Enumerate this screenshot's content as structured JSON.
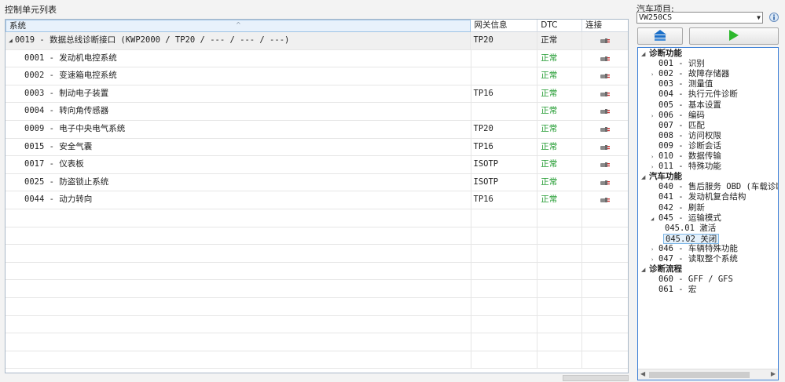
{
  "left": {
    "title": "控制单元列表",
    "columns": {
      "system": "系统",
      "gateway": "网关信息",
      "dtc": "DTC",
      "connect": "连接"
    },
    "group": {
      "system": "0019 - 数据总线诊断接口  (KWP2000 / TP20 / --- / --- / ---)",
      "gateway": "TP20",
      "dtc": "正常"
    },
    "rows": [
      {
        "system": "0001 - 发动机电控系统",
        "gateway": "",
        "dtc": "正常"
      },
      {
        "system": "0002 - 变速箱电控系统",
        "gateway": "",
        "dtc": "正常"
      },
      {
        "system": "0003 - 制动电子装置",
        "gateway": "TP16",
        "dtc": "正常"
      },
      {
        "system": "0004 - 转向角传感器",
        "gateway": "",
        "dtc": "正常"
      },
      {
        "system": "0009 - 电子中央电气系统",
        "gateway": "TP20",
        "dtc": "正常"
      },
      {
        "system": "0015 - 安全气囊",
        "gateway": "TP16",
        "dtc": "正常"
      },
      {
        "system": "0017 - 仪表板",
        "gateway": "ISOTP",
        "dtc": "正常"
      },
      {
        "system": "0025 - 防盗锁止系统",
        "gateway": "ISOTP",
        "dtc": "正常"
      },
      {
        "system": "0044 - 动力转向",
        "gateway": "TP16",
        "dtc": "正常"
      }
    ]
  },
  "right": {
    "vehicle_label": "汽车项目:",
    "vehicle_value": "VW250CS",
    "tree": [
      {
        "text": "诊断功能",
        "kind": "cat",
        "exp": "◢"
      },
      {
        "text": "001 - 识别",
        "kind": "item",
        "exp": ""
      },
      {
        "text": "002 - 故障存储器",
        "kind": "item",
        "exp": "›"
      },
      {
        "text": "003 - 测量值",
        "kind": "item",
        "exp": ""
      },
      {
        "text": "004 - 执行元件诊断",
        "kind": "item",
        "exp": ""
      },
      {
        "text": "005 - 基本设置",
        "kind": "item",
        "exp": ""
      },
      {
        "text": "006 - 编码",
        "kind": "item",
        "exp": "›"
      },
      {
        "text": "007 - 匹配",
        "kind": "item",
        "exp": ""
      },
      {
        "text": "008 - 访问权限",
        "kind": "item",
        "exp": ""
      },
      {
        "text": "009 - 诊断会话",
        "kind": "item",
        "exp": ""
      },
      {
        "text": "010 - 数据传输",
        "kind": "item",
        "exp": "›"
      },
      {
        "text": "011 - 特殊功能",
        "kind": "item",
        "exp": "›"
      },
      {
        "text": "汽车功能",
        "kind": "cat",
        "exp": "◢"
      },
      {
        "text": "040 - 售后服务 OBD (车载诊断",
        "kind": "item",
        "exp": ""
      },
      {
        "text": "041 - 发动机复合结构",
        "kind": "item",
        "exp": ""
      },
      {
        "text": "042 - 刷新",
        "kind": "item",
        "exp": ""
      },
      {
        "text": "045 - 运输模式",
        "kind": "item",
        "exp": "◢"
      },
      {
        "text": "045.01 激活",
        "kind": "sub",
        "exp": ""
      },
      {
        "text": "045.02 关闭",
        "kind": "subsel",
        "exp": ""
      },
      {
        "text": "046 - 车辆特殊功能",
        "kind": "item",
        "exp": "›"
      },
      {
        "text": "047 - 读取整个系统",
        "kind": "item",
        "exp": "›"
      },
      {
        "text": "诊断流程",
        "kind": "cat",
        "exp": "◢"
      },
      {
        "text": "060 - GFF / GFS",
        "kind": "item",
        "exp": ""
      },
      {
        "text": "061 - 宏",
        "kind": "item",
        "exp": ""
      }
    ]
  },
  "colors": {
    "ok_green": "#1f9a2e",
    "home_blue": "#1a6fc9",
    "play_green": "#2db82d"
  },
  "icons": {
    "connect": "plug-icon",
    "home": "home-icon",
    "play": "play-icon",
    "info": "info-icon"
  }
}
